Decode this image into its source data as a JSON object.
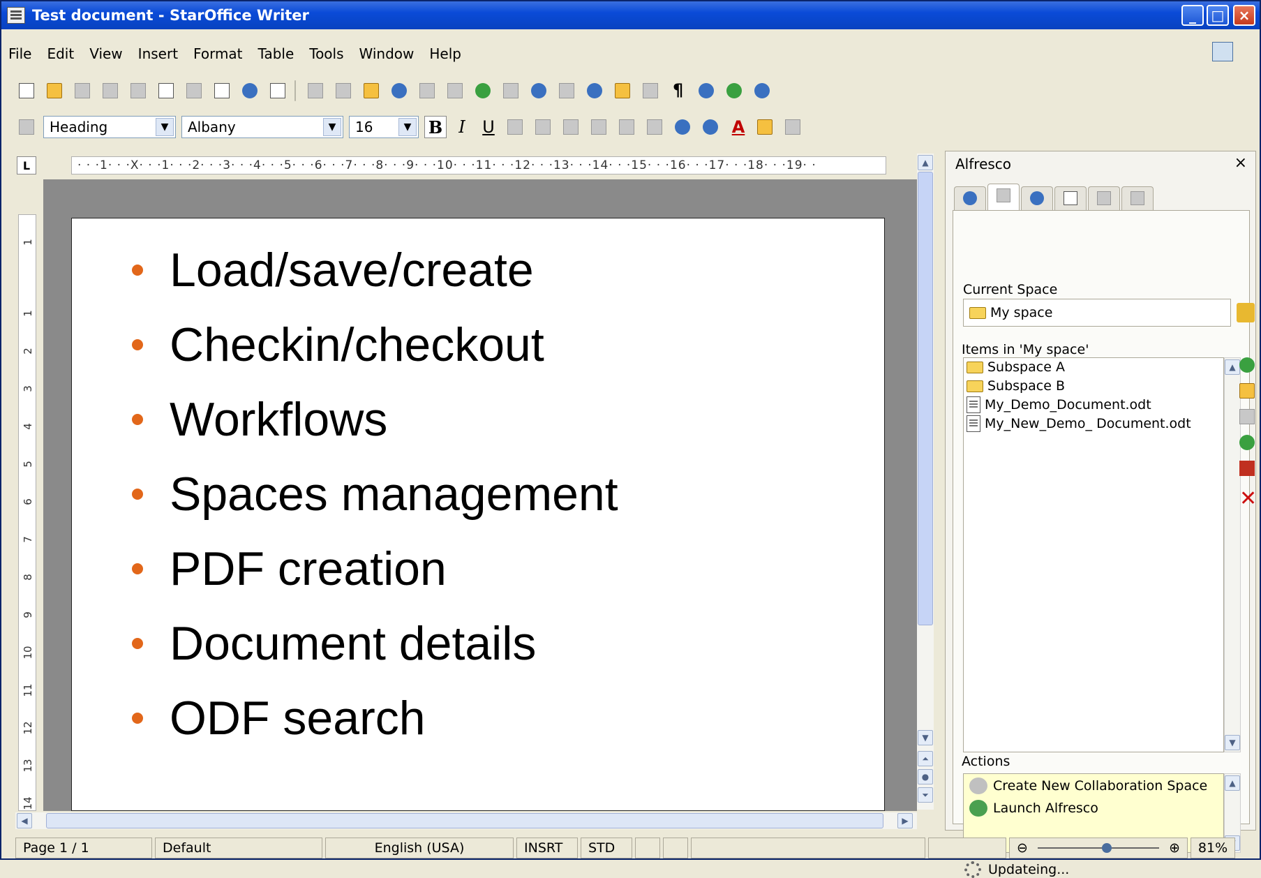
{
  "window": {
    "title": "Test document",
    "app_name": "StarOffice Writer",
    "title_sep": "-",
    "min": "_",
    "max": "□",
    "close": "×"
  },
  "menu": [
    "File",
    "Edit",
    "View",
    "Insert",
    "Format",
    "Table",
    "Tools",
    "Window",
    "Help"
  ],
  "format_bar": {
    "style": "Heading",
    "font": "Albany",
    "size": "16",
    "bold": "B",
    "italic": "I",
    "underline": "U",
    "font_color": "A"
  },
  "ruler": {
    "corner": "L",
    "h_text": "· · ·1· · ·X· · ·1· · ·2· · ·3· · ·4· · ·5· · ·6· · ·7· · ·8· · ·9· · ·10· · ·11· · ·12· · ·13· · ·14· · ·15· · ·16· · ·17· · ·18· · ·19· ·",
    "v_ticks": [
      "1",
      "1",
      "2",
      "3",
      "4",
      "5",
      "6",
      "7",
      "8",
      "9",
      "10",
      "11",
      "12",
      "13",
      "14"
    ]
  },
  "document": {
    "bullet_color": "#e2671a",
    "bullets": [
      "Load/save/create",
      "Checkin/checkout",
      "Workflows",
      "Spaces management",
      "PDF creation",
      "Document details",
      "ODF search"
    ]
  },
  "alfresco": {
    "title": "Alfresco",
    "close": "×",
    "current_space_label": "Current Space",
    "current_space": "My space",
    "items_label": "Items in 'My space'",
    "items": [
      {
        "name": "Subspace A",
        "type": "folder"
      },
      {
        "name": "Subspace B",
        "type": "folder"
      },
      {
        "name": "My_Demo_Document.odt",
        "type": "file"
      },
      {
        "name": "My_New_Demo_ Document.odt",
        "type": "file"
      }
    ],
    "actions_label": "Actions",
    "actions": [
      "Create New Collaboration Space",
      "Launch Alfresco"
    ],
    "status": "Updateing..."
  },
  "statusbar": {
    "page": "Page 1 / 1",
    "style": "Default",
    "language": "English (USA)",
    "insert_mode": "INSRT",
    "selection_mode": "STD",
    "zoom": "81%",
    "zoom_minus": "⊖",
    "zoom_plus": "⊕"
  }
}
